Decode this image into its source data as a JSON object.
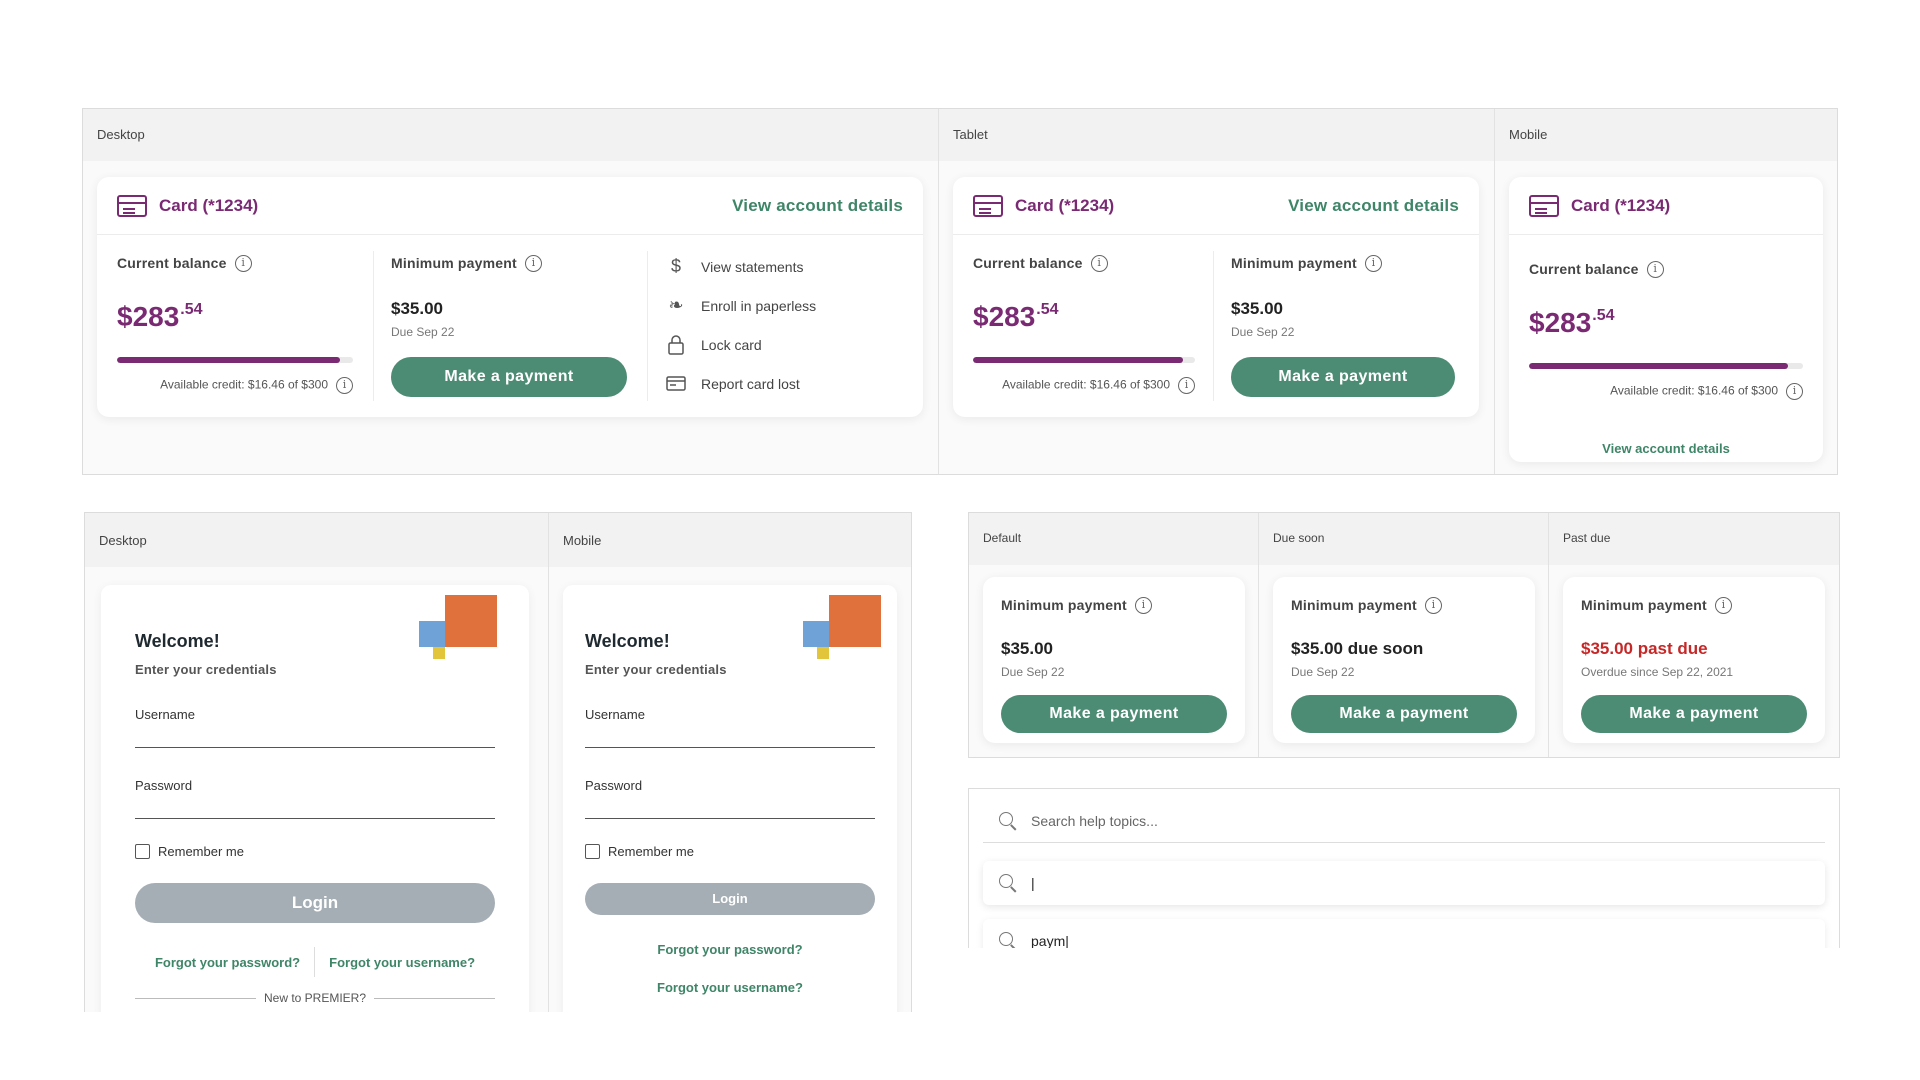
{
  "account_panel": {
    "columns": [
      "Desktop",
      "Tablet",
      "Mobile"
    ],
    "card_title": "Card (*1234)",
    "view_details": "View account details",
    "current_balance_label": "Current balance",
    "balance_dollars": "$283",
    "balance_cents": ".54",
    "credit_used_fraction": 0.945,
    "available_credit": "Available credit: $16.46 of $300",
    "min_payment_label": "Minimum payment",
    "min_payment_amount": "$35.00",
    "due_date": "Due Sep 22",
    "make_payment": "Make a payment",
    "actions": [
      {
        "icon": "dollar-icon",
        "label": "View statements"
      },
      {
        "icon": "leaf-icon",
        "label": "Enroll in paperless"
      },
      {
        "icon": "lock-icon",
        "label": "Lock card"
      },
      {
        "icon": "card-icon",
        "label": "Report card lost"
      }
    ]
  },
  "login_panel": {
    "columns": [
      "Desktop",
      "Mobile"
    ],
    "welcome": "Welcome!",
    "subtitle": "Enter your credentials",
    "username_label": "Username",
    "password_label": "Password",
    "remember_me": "Remember me",
    "login": "Login",
    "forgot_password": "Forgot your password?",
    "forgot_username": "Forgot your username?",
    "new_to": "New to PREMIER?"
  },
  "payment_states": {
    "columns": [
      "Default",
      "Due soon",
      "Past due"
    ],
    "label": "Minimum payment",
    "cards": [
      {
        "amount": "$35.00",
        "note": "Due Sep 22",
        "color": "#222222"
      },
      {
        "amount": "$35.00 due soon",
        "note": "Due Sep 22",
        "color": "#222222"
      },
      {
        "amount": "$35.00 past due",
        "note": "Overdue since Sep 22, 2021",
        "color": "#c62828"
      }
    ],
    "button": "Make a payment"
  },
  "search_panel": {
    "placeholder": "Search help topics...",
    "typing_value": "|",
    "typed_value": "paym|"
  }
}
